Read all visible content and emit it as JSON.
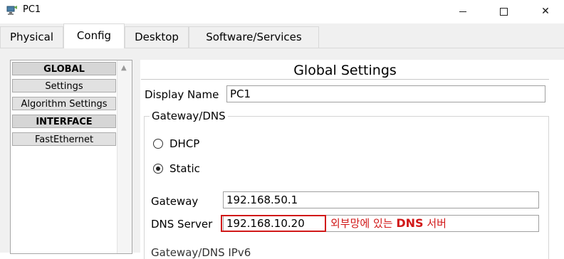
{
  "window": {
    "title": "PC1",
    "controls": {
      "minimize": "—",
      "maximize": "☐",
      "close": "✕"
    }
  },
  "tabs": [
    {
      "label": "Physical",
      "active": false
    },
    {
      "label": "Config",
      "active": true
    },
    {
      "label": "Desktop",
      "active": false
    },
    {
      "label": "Software/Services",
      "active": false
    }
  ],
  "sidebar": {
    "items": [
      {
        "label": "GLOBAL",
        "header": true
      },
      {
        "label": "Settings",
        "header": false
      },
      {
        "label": "Algorithm Settings",
        "header": false
      },
      {
        "label": "INTERFACE",
        "header": true
      },
      {
        "label": "FastEthernet",
        "header": false
      }
    ]
  },
  "global_settings": {
    "title": "Global Settings",
    "display_name_label": "Display Name",
    "display_name_value": "PC1",
    "gateway_dns_legend": "Gateway/DNS",
    "dhcp_label": "DHCP",
    "static_label": "Static",
    "selected_mode": "Static",
    "gateway_label": "Gateway",
    "gateway_value": "192.168.50.1",
    "dns_label": "DNS Server",
    "dns_value": "192.168.10.20",
    "next_partial": "Gateway/DNS IPv6"
  },
  "annotation": {
    "prefix": "외부망에 있는",
    "bold": "DNS",
    "suffix": "서버",
    "color": "#d11919"
  }
}
